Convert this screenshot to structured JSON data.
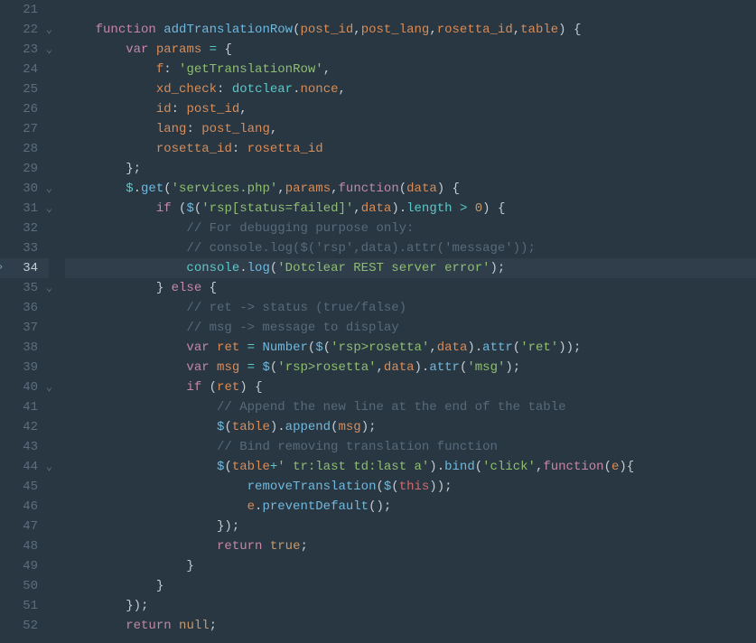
{
  "lines": [
    {
      "num": "21",
      "fold": false,
      "active": false,
      "diff": false,
      "tokens": []
    },
    {
      "num": "22",
      "fold": true,
      "active": false,
      "diff": false,
      "tokens": [
        {
          "t": "    ",
          "c": ""
        },
        {
          "t": "function",
          "c": "tok-kw"
        },
        {
          "t": " ",
          "c": ""
        },
        {
          "t": "addTranslationRow",
          "c": "tok-fn"
        },
        {
          "t": "(",
          "c": "tok-punct"
        },
        {
          "t": "post_id",
          "c": "tok-param"
        },
        {
          "t": ",",
          "c": "tok-punct"
        },
        {
          "t": "post_lang",
          "c": "tok-param"
        },
        {
          "t": ",",
          "c": "tok-punct"
        },
        {
          "t": "rosetta_id",
          "c": "tok-param"
        },
        {
          "t": ",",
          "c": "tok-punct"
        },
        {
          "t": "table",
          "c": "tok-param"
        },
        {
          "t": ") {",
          "c": "tok-punct"
        }
      ]
    },
    {
      "num": "23",
      "fold": true,
      "active": false,
      "diff": false,
      "tokens": [
        {
          "t": "        ",
          "c": ""
        },
        {
          "t": "var",
          "c": "tok-kw"
        },
        {
          "t": " ",
          "c": ""
        },
        {
          "t": "params",
          "c": "tok-param"
        },
        {
          "t": " ",
          "c": ""
        },
        {
          "t": "=",
          "c": "tok-op"
        },
        {
          "t": " {",
          "c": "tok-punct"
        }
      ]
    },
    {
      "num": "24",
      "fold": false,
      "active": false,
      "diff": false,
      "tokens": [
        {
          "t": "            ",
          "c": ""
        },
        {
          "t": "f",
          "c": "tok-prop"
        },
        {
          "t": ": ",
          "c": "tok-punct"
        },
        {
          "t": "'getTranslationRow'",
          "c": "tok-str"
        },
        {
          "t": ",",
          "c": "tok-punct"
        }
      ]
    },
    {
      "num": "25",
      "fold": false,
      "active": false,
      "diff": false,
      "tokens": [
        {
          "t": "            ",
          "c": ""
        },
        {
          "t": "xd_check",
          "c": "tok-prop"
        },
        {
          "t": ": ",
          "c": "tok-punct"
        },
        {
          "t": "dotclear",
          "c": "tok-id"
        },
        {
          "t": ".",
          "c": "tok-punct"
        },
        {
          "t": "nonce",
          "c": "tok-param"
        },
        {
          "t": ",",
          "c": "tok-punct"
        }
      ]
    },
    {
      "num": "26",
      "fold": false,
      "active": false,
      "diff": false,
      "tokens": [
        {
          "t": "            ",
          "c": ""
        },
        {
          "t": "id",
          "c": "tok-prop"
        },
        {
          "t": ": ",
          "c": "tok-punct"
        },
        {
          "t": "post_id",
          "c": "tok-param"
        },
        {
          "t": ",",
          "c": "tok-punct"
        }
      ]
    },
    {
      "num": "27",
      "fold": false,
      "active": false,
      "diff": false,
      "tokens": [
        {
          "t": "            ",
          "c": ""
        },
        {
          "t": "lang",
          "c": "tok-prop"
        },
        {
          "t": ": ",
          "c": "tok-punct"
        },
        {
          "t": "post_lang",
          "c": "tok-param"
        },
        {
          "t": ",",
          "c": "tok-punct"
        }
      ]
    },
    {
      "num": "28",
      "fold": false,
      "active": false,
      "diff": false,
      "tokens": [
        {
          "t": "            ",
          "c": ""
        },
        {
          "t": "rosetta_id",
          "c": "tok-prop"
        },
        {
          "t": ": ",
          "c": "tok-punct"
        },
        {
          "t": "rosetta_id",
          "c": "tok-param"
        }
      ]
    },
    {
      "num": "29",
      "fold": false,
      "active": false,
      "diff": false,
      "tokens": [
        {
          "t": "        };",
          "c": "tok-punct"
        }
      ]
    },
    {
      "num": "30",
      "fold": true,
      "active": false,
      "diff": false,
      "tokens": [
        {
          "t": "        ",
          "c": ""
        },
        {
          "t": "$",
          "c": "tok-id"
        },
        {
          "t": ".",
          "c": "tok-punct"
        },
        {
          "t": "get",
          "c": "tok-fn"
        },
        {
          "t": "(",
          "c": "tok-punct"
        },
        {
          "t": "'services.php'",
          "c": "tok-str"
        },
        {
          "t": ",",
          "c": "tok-punct"
        },
        {
          "t": "params",
          "c": "tok-param"
        },
        {
          "t": ",",
          "c": "tok-punct"
        },
        {
          "t": "function",
          "c": "tok-kw"
        },
        {
          "t": "(",
          "c": "tok-punct"
        },
        {
          "t": "data",
          "c": "tok-param"
        },
        {
          "t": ") {",
          "c": "tok-punct"
        }
      ]
    },
    {
      "num": "31",
      "fold": true,
      "active": false,
      "diff": false,
      "tokens": [
        {
          "t": "            ",
          "c": ""
        },
        {
          "t": "if",
          "c": "tok-kw"
        },
        {
          "t": " (",
          "c": "tok-punct"
        },
        {
          "t": "$",
          "c": "tok-fn"
        },
        {
          "t": "(",
          "c": "tok-punct"
        },
        {
          "t": "'rsp[status=failed]'",
          "c": "tok-str"
        },
        {
          "t": ",",
          "c": "tok-punct"
        },
        {
          "t": "data",
          "c": "tok-param"
        },
        {
          "t": ").",
          "c": "tok-punct"
        },
        {
          "t": "length",
          "c": "tok-id"
        },
        {
          "t": " ",
          "c": ""
        },
        {
          "t": ">",
          "c": "tok-op"
        },
        {
          "t": " ",
          "c": ""
        },
        {
          "t": "0",
          "c": "tok-num"
        },
        {
          "t": ") {",
          "c": "tok-punct"
        }
      ]
    },
    {
      "num": "32",
      "fold": false,
      "active": false,
      "diff": false,
      "tokens": [
        {
          "t": "                ",
          "c": ""
        },
        {
          "t": "// For debugging purpose only:",
          "c": "tok-comm"
        }
      ]
    },
    {
      "num": "33",
      "fold": false,
      "active": false,
      "diff": false,
      "tokens": [
        {
          "t": "                ",
          "c": ""
        },
        {
          "t": "// console.log($('rsp',data).attr('message'));",
          "c": "tok-comm"
        }
      ]
    },
    {
      "num": "34",
      "fold": false,
      "active": true,
      "diff": true,
      "tokens": [
        {
          "t": "                ",
          "c": ""
        },
        {
          "t": "console",
          "c": "tok-id"
        },
        {
          "t": ".",
          "c": "tok-punct"
        },
        {
          "t": "log",
          "c": "tok-fn"
        },
        {
          "t": "(",
          "c": "tok-punct"
        },
        {
          "t": "'Dotclear REST server error'",
          "c": "tok-str"
        },
        {
          "t": ");",
          "c": "tok-punct"
        }
      ]
    },
    {
      "num": "35",
      "fold": true,
      "active": false,
      "diff": false,
      "tokens": [
        {
          "t": "            } ",
          "c": "tok-punct"
        },
        {
          "t": "else",
          "c": "tok-kw"
        },
        {
          "t": " {",
          "c": "tok-punct"
        }
      ]
    },
    {
      "num": "36",
      "fold": false,
      "active": false,
      "diff": false,
      "tokens": [
        {
          "t": "                ",
          "c": ""
        },
        {
          "t": "// ret -> status (true/false)",
          "c": "tok-comm"
        }
      ]
    },
    {
      "num": "37",
      "fold": false,
      "active": false,
      "diff": false,
      "tokens": [
        {
          "t": "                ",
          "c": ""
        },
        {
          "t": "// msg -> message to display",
          "c": "tok-comm"
        }
      ]
    },
    {
      "num": "38",
      "fold": false,
      "active": false,
      "diff": false,
      "tokens": [
        {
          "t": "                ",
          "c": ""
        },
        {
          "t": "var",
          "c": "tok-kw"
        },
        {
          "t": " ",
          "c": ""
        },
        {
          "t": "ret",
          "c": "tok-param"
        },
        {
          "t": " ",
          "c": ""
        },
        {
          "t": "=",
          "c": "tok-op"
        },
        {
          "t": " ",
          "c": ""
        },
        {
          "t": "Number",
          "c": "tok-fn"
        },
        {
          "t": "(",
          "c": "tok-punct"
        },
        {
          "t": "$",
          "c": "tok-fn"
        },
        {
          "t": "(",
          "c": "tok-punct"
        },
        {
          "t": "'rsp>rosetta'",
          "c": "tok-str"
        },
        {
          "t": ",",
          "c": "tok-punct"
        },
        {
          "t": "data",
          "c": "tok-param"
        },
        {
          "t": ").",
          "c": "tok-punct"
        },
        {
          "t": "attr",
          "c": "tok-fn"
        },
        {
          "t": "(",
          "c": "tok-punct"
        },
        {
          "t": "'ret'",
          "c": "tok-str"
        },
        {
          "t": "));",
          "c": "tok-punct"
        }
      ]
    },
    {
      "num": "39",
      "fold": false,
      "active": false,
      "diff": false,
      "tokens": [
        {
          "t": "                ",
          "c": ""
        },
        {
          "t": "var",
          "c": "tok-kw"
        },
        {
          "t": " ",
          "c": ""
        },
        {
          "t": "msg",
          "c": "tok-param"
        },
        {
          "t": " ",
          "c": ""
        },
        {
          "t": "=",
          "c": "tok-op"
        },
        {
          "t": " ",
          "c": ""
        },
        {
          "t": "$",
          "c": "tok-fn"
        },
        {
          "t": "(",
          "c": "tok-punct"
        },
        {
          "t": "'rsp>rosetta'",
          "c": "tok-str"
        },
        {
          "t": ",",
          "c": "tok-punct"
        },
        {
          "t": "data",
          "c": "tok-param"
        },
        {
          "t": ").",
          "c": "tok-punct"
        },
        {
          "t": "attr",
          "c": "tok-fn"
        },
        {
          "t": "(",
          "c": "tok-punct"
        },
        {
          "t": "'msg'",
          "c": "tok-str"
        },
        {
          "t": ");",
          "c": "tok-punct"
        }
      ]
    },
    {
      "num": "40",
      "fold": true,
      "active": false,
      "diff": false,
      "tokens": [
        {
          "t": "                ",
          "c": ""
        },
        {
          "t": "if",
          "c": "tok-kw"
        },
        {
          "t": " (",
          "c": "tok-punct"
        },
        {
          "t": "ret",
          "c": "tok-param"
        },
        {
          "t": ") {",
          "c": "tok-punct"
        }
      ]
    },
    {
      "num": "41",
      "fold": false,
      "active": false,
      "diff": false,
      "tokens": [
        {
          "t": "                    ",
          "c": ""
        },
        {
          "t": "// Append the new line at the end of the table",
          "c": "tok-comm"
        }
      ]
    },
    {
      "num": "42",
      "fold": false,
      "active": false,
      "diff": false,
      "tokens": [
        {
          "t": "                    ",
          "c": ""
        },
        {
          "t": "$",
          "c": "tok-fn"
        },
        {
          "t": "(",
          "c": "tok-punct"
        },
        {
          "t": "table",
          "c": "tok-param"
        },
        {
          "t": ").",
          "c": "tok-punct"
        },
        {
          "t": "append",
          "c": "tok-fn"
        },
        {
          "t": "(",
          "c": "tok-punct"
        },
        {
          "t": "msg",
          "c": "tok-param"
        },
        {
          "t": ");",
          "c": "tok-punct"
        }
      ]
    },
    {
      "num": "43",
      "fold": false,
      "active": false,
      "diff": false,
      "tokens": [
        {
          "t": "                    ",
          "c": ""
        },
        {
          "t": "// Bind removing translation function",
          "c": "tok-comm"
        }
      ]
    },
    {
      "num": "44",
      "fold": true,
      "active": false,
      "diff": false,
      "tokens": [
        {
          "t": "                    ",
          "c": ""
        },
        {
          "t": "$",
          "c": "tok-fn"
        },
        {
          "t": "(",
          "c": "tok-punct"
        },
        {
          "t": "table",
          "c": "tok-param"
        },
        {
          "t": "+",
          "c": "tok-op"
        },
        {
          "t": "' tr:last td:last a'",
          "c": "tok-str"
        },
        {
          "t": ").",
          "c": "tok-punct"
        },
        {
          "t": "bind",
          "c": "tok-fn"
        },
        {
          "t": "(",
          "c": "tok-punct"
        },
        {
          "t": "'click'",
          "c": "tok-str"
        },
        {
          "t": ",",
          "c": "tok-punct"
        },
        {
          "t": "function",
          "c": "tok-kw"
        },
        {
          "t": "(",
          "c": "tok-punct"
        },
        {
          "t": "e",
          "c": "tok-param"
        },
        {
          "t": "){",
          "c": "tok-punct"
        }
      ]
    },
    {
      "num": "45",
      "fold": false,
      "active": false,
      "diff": false,
      "tokens": [
        {
          "t": "                        ",
          "c": ""
        },
        {
          "t": "removeTranslation",
          "c": "tok-fn"
        },
        {
          "t": "(",
          "c": "tok-punct"
        },
        {
          "t": "$",
          "c": "tok-fn"
        },
        {
          "t": "(",
          "c": "tok-punct"
        },
        {
          "t": "this",
          "c": "tok-this"
        },
        {
          "t": "));",
          "c": "tok-punct"
        }
      ]
    },
    {
      "num": "46",
      "fold": false,
      "active": false,
      "diff": false,
      "tokens": [
        {
          "t": "                        ",
          "c": ""
        },
        {
          "t": "e",
          "c": "tok-param"
        },
        {
          "t": ".",
          "c": "tok-punct"
        },
        {
          "t": "preventDefault",
          "c": "tok-fn"
        },
        {
          "t": "();",
          "c": "tok-punct"
        }
      ]
    },
    {
      "num": "47",
      "fold": false,
      "active": false,
      "diff": false,
      "tokens": [
        {
          "t": "                    });",
          "c": "tok-punct"
        }
      ]
    },
    {
      "num": "48",
      "fold": false,
      "active": false,
      "diff": false,
      "tokens": [
        {
          "t": "                    ",
          "c": ""
        },
        {
          "t": "return",
          "c": "tok-kw"
        },
        {
          "t": " ",
          "c": ""
        },
        {
          "t": "true",
          "c": "tok-num"
        },
        {
          "t": ";",
          "c": "tok-punct"
        }
      ]
    },
    {
      "num": "49",
      "fold": false,
      "active": false,
      "diff": false,
      "tokens": [
        {
          "t": "                }",
          "c": "tok-punct"
        }
      ]
    },
    {
      "num": "50",
      "fold": false,
      "active": false,
      "diff": false,
      "tokens": [
        {
          "t": "            }",
          "c": "tok-punct"
        }
      ]
    },
    {
      "num": "51",
      "fold": false,
      "active": false,
      "diff": false,
      "tokens": [
        {
          "t": "        });",
          "c": "tok-punct"
        }
      ]
    },
    {
      "num": "52",
      "fold": false,
      "active": false,
      "diff": false,
      "tokens": [
        {
          "t": "        ",
          "c": ""
        },
        {
          "t": "return",
          "c": "tok-kw"
        },
        {
          "t": " ",
          "c": ""
        },
        {
          "t": "null",
          "c": "tok-num"
        },
        {
          "t": ";",
          "c": "tok-punct"
        }
      ]
    }
  ]
}
